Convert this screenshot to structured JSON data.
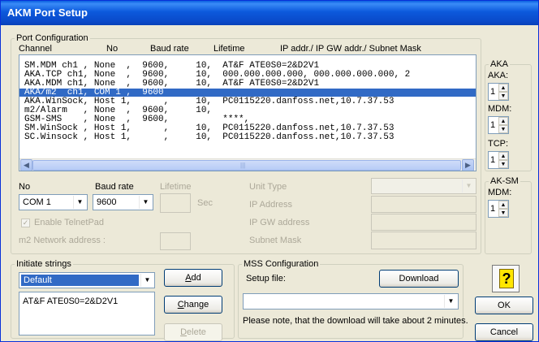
{
  "window": {
    "title": "AKM Port Setup"
  },
  "port_config": {
    "legend": "Port Configuration",
    "headers": {
      "channel": "Channel",
      "no": "No",
      "baud": "Baud rate",
      "lifetime": "Lifetime",
      "ip": "IP addr./ IP GW addr./ Subnet Mask"
    },
    "rows": [
      "SM.MDM ch1 , None  ,  9600,     10,  AT&F ATE0S0=2&D2V1",
      "AKA.TCP ch1, None  ,  9600,     10,  000.000.000.000, 000.000.000.000, 2",
      "AKA.MDM ch1, None  ,  9600,     10,  AT&F ATE0S0=2&D2V1",
      "AKA/m2  ch1, COM 1 ,  9600",
      "AKA.WinSock, Host 1,      ,     10,  PC0115220.danfoss.net,10.7.37.53",
      "m2/Alarm   , None  ,  9600,     10,",
      "GSM-SMS    , None  ,  9600,          ****,",
      "SM.WinSock , Host 1,      ,     10,  PC0115220.danfoss.net,10.7.37.53",
      "SC.Winsock , Host 1,      ,     10,  PC0115220.danfoss.net,10.7.37.53"
    ],
    "selected_row": 3,
    "no_label": "No",
    "baud_label": "Baud rate",
    "lifetime_label": "Lifetime",
    "no_value": "COM 1",
    "baud_value": "9600",
    "sec_label": "Sec",
    "enable_telnetpad": "Enable TelnetPad",
    "m2_network_address": "m2 Network address :",
    "unit_type": "Unit Type",
    "ip_address": "IP Address",
    "ip_gw_address": "IP GW address",
    "subnet_mask": "Subnet Mask"
  },
  "aka": {
    "legend": "AKA",
    "aka_label": "AKA:",
    "aka_value": "1",
    "mdm_label": "MDM:",
    "mdm_value": "1",
    "tcp_label": "TCP:",
    "tcp_value": "1"
  },
  "aksm": {
    "legend": "AK-SM",
    "mdm_label": "MDM:",
    "mdm_value": "1"
  },
  "initiate": {
    "legend": "Initiate strings",
    "selected": "Default",
    "value": "AT&F ATE0S0=2&D2V1",
    "add_prefix": "",
    "add_key": "A",
    "add_rest": "dd",
    "change_prefix": "",
    "change_key": "C",
    "change_rest": "hange",
    "delete_prefix": "",
    "delete_key": "D",
    "delete_rest": "elete"
  },
  "mss": {
    "legend": "MSS Configuration",
    "setup_file": "Setup file:",
    "download": "Download",
    "note": "Please note, that the download will take about 2 minutes."
  },
  "dialog": {
    "ok": "OK",
    "cancel": "Cancel"
  }
}
